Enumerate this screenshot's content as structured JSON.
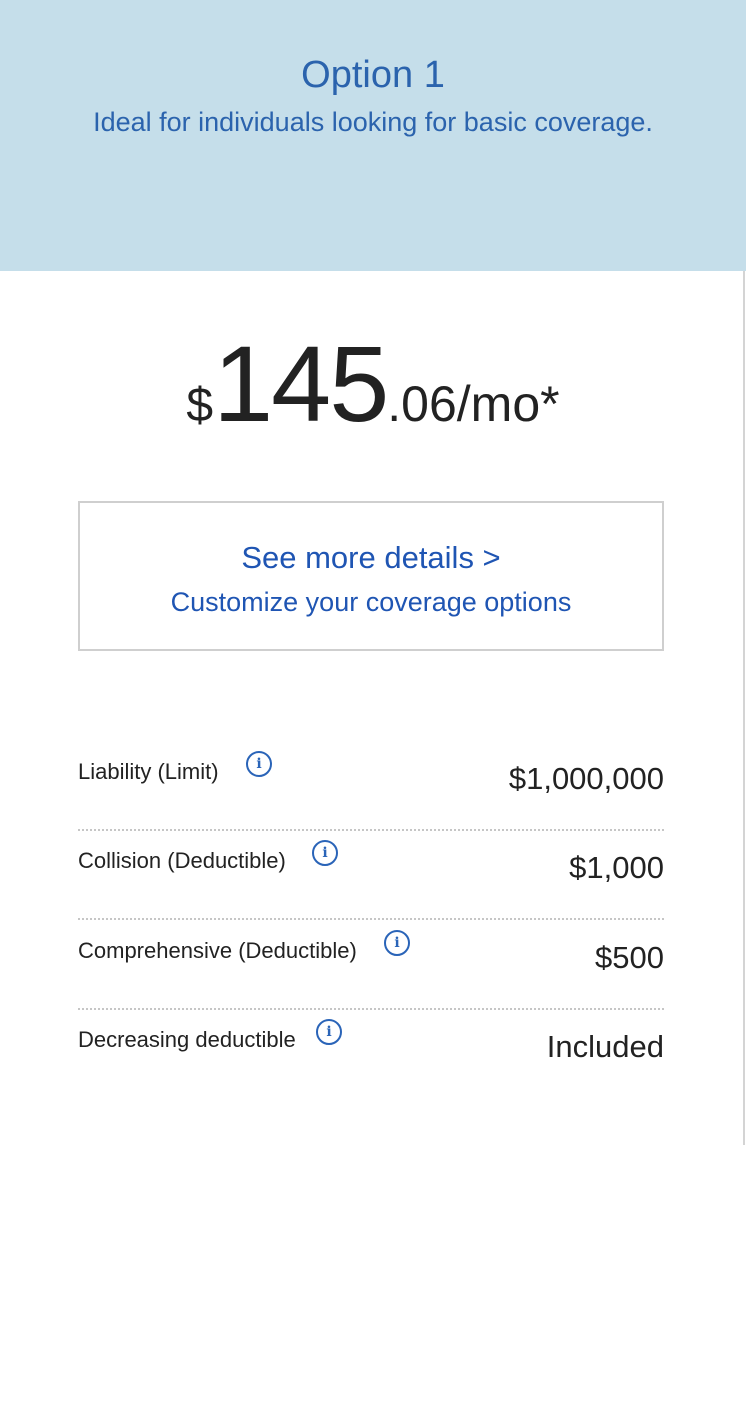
{
  "option": {
    "title": "Option 1",
    "subtitle": "Ideal for individuals looking for basic coverage."
  },
  "price": {
    "currency": "$",
    "dollars": "145",
    "cents_period": ".06/mo*"
  },
  "details": {
    "see_more": "See more details >",
    "customize": "Customize your coverage options"
  },
  "coverages": [
    {
      "label": "Liability (Limit)",
      "value": "$1,000,000",
      "icon": "info-icon"
    },
    {
      "label": "Collision (Deductible)",
      "value": "$1,000",
      "icon": "info-icon"
    },
    {
      "label": "Comprehensive (Deductible)",
      "value": "$500",
      "icon": "info-icon"
    },
    {
      "label": "Decreasing deductible",
      "value": "Included",
      "icon": "info-icon"
    }
  ],
  "colors": {
    "header_bg": "#c5deea",
    "header_text": "#2b63ad",
    "link": "#1f55b3",
    "text": "#222222"
  }
}
